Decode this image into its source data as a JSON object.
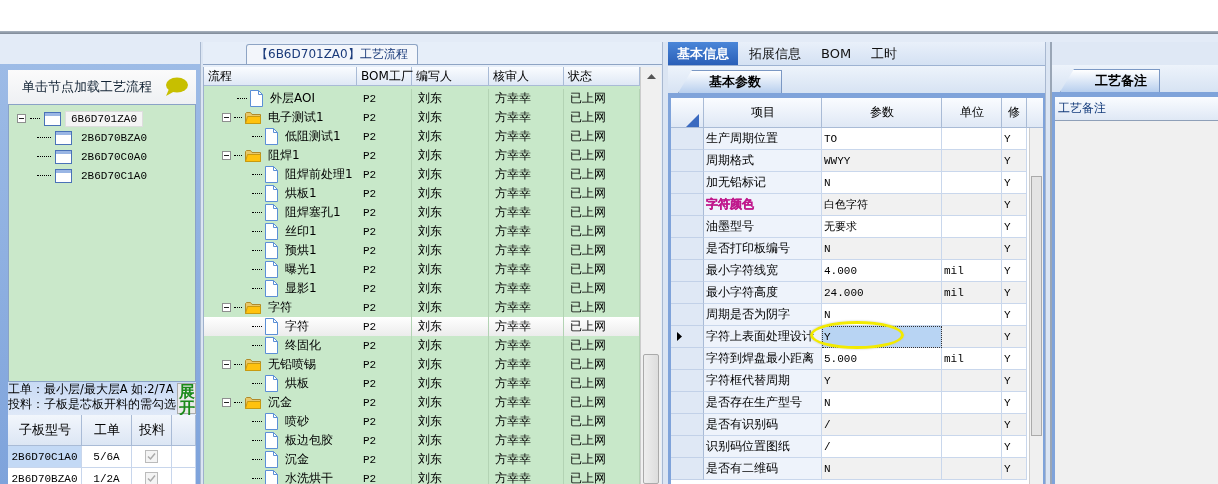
{
  "left_panel": {
    "header": "单击节点加载工艺流程",
    "tree": [
      {
        "label": "6B6D701ZA0",
        "expanded": true,
        "selected": true,
        "children": [
          {
            "label": "2B6D70BZA0",
            "selected": false
          },
          {
            "label": "2B6D70C0A0",
            "selected": false
          },
          {
            "label": "2B6D70C1A0",
            "selected": false
          }
        ]
      }
    ],
    "hint_lines": [
      "工单：最小层/最大层A 如:2/7A",
      "投料：子板是芯板开料的需勾选"
    ],
    "expand_button": "展开",
    "grid": {
      "columns": [
        "子板型号",
        "工单",
        "投料"
      ],
      "rows": [
        {
          "cells": [
            "2B6D70C1A0",
            "5/6A"
          ],
          "checked": true,
          "selected": true
        },
        {
          "cells": [
            "2B6D70BZA0",
            "1/2A"
          ],
          "checked": true,
          "selected": false
        }
      ]
    }
  },
  "flow_panel": {
    "title": "【6B6D701ZA0】工艺流程",
    "columns": [
      "流程",
      "BOM工厂",
      "编写人",
      "核审人",
      "状态"
    ],
    "tree": [
      {
        "kind": "step",
        "label": "外层AOI",
        "cells": [
          "P2",
          "刘东",
          "方幸幸",
          "已上网"
        ],
        "selected": false
      },
      {
        "kind": "folder",
        "label": "电子测试1",
        "cells": [
          "P2",
          "刘东",
          "方幸幸",
          "已上网"
        ],
        "expanded": true,
        "selected": false,
        "children": [
          {
            "kind": "step",
            "label": "低阻测试1",
            "cells": [
              "P2",
              "刘东",
              "方幸幸",
              "已上网"
            ],
            "selected": false
          }
        ]
      },
      {
        "kind": "folder",
        "label": "阻焊1",
        "cells": [
          "P2",
          "刘东",
          "方幸幸",
          "已上网"
        ],
        "expanded": true,
        "selected": false,
        "children": [
          {
            "kind": "step",
            "label": "阻焊前处理1",
            "cells": [
              "P2",
              "刘东",
              "方幸幸",
              "已上网"
            ],
            "selected": false
          },
          {
            "kind": "step",
            "label": "烘板1",
            "cells": [
              "P2",
              "刘东",
              "方幸幸",
              "已上网"
            ],
            "selected": false
          },
          {
            "kind": "step",
            "label": "阻焊塞孔1",
            "cells": [
              "P2",
              "刘东",
              "方幸幸",
              "已上网"
            ],
            "selected": false
          },
          {
            "kind": "step",
            "label": "丝印1",
            "cells": [
              "P2",
              "刘东",
              "方幸幸",
              "已上网"
            ],
            "selected": false
          },
          {
            "kind": "step",
            "label": "预烘1",
            "cells": [
              "P2",
              "刘东",
              "方幸幸",
              "已上网"
            ],
            "selected": false
          },
          {
            "kind": "step",
            "label": "曝光1",
            "cells": [
              "P2",
              "刘东",
              "方幸幸",
              "已上网"
            ],
            "selected": false
          },
          {
            "kind": "step",
            "label": "显影1",
            "cells": [
              "P2",
              "刘东",
              "方幸幸",
              "已上网"
            ],
            "selected": false
          }
        ]
      },
      {
        "kind": "folder",
        "label": "字符",
        "cells": [
          "P2",
          "刘东",
          "方幸幸",
          "已上网"
        ],
        "expanded": true,
        "selected": false,
        "children": [
          {
            "kind": "step",
            "label": "字符",
            "cells": [
              "P2",
              "刘东",
              "方幸幸",
              "已上网"
            ],
            "selected": true
          },
          {
            "kind": "step",
            "label": "终固化",
            "cells": [
              "P2",
              "刘东",
              "方幸幸",
              "已上网"
            ],
            "selected": false
          }
        ]
      },
      {
        "kind": "folder",
        "label": "无铅喷锡",
        "cells": [
          "P2",
          "刘东",
          "方幸幸",
          "已上网"
        ],
        "expanded": true,
        "selected": false,
        "children": [
          {
            "kind": "step",
            "label": "烘板",
            "cells": [
              "P2",
              "刘东",
              "方幸幸",
              "已上网"
            ],
            "selected": false
          }
        ]
      },
      {
        "kind": "folder",
        "label": "沉金",
        "cells": [
          "P2",
          "刘东",
          "方幸幸",
          "已上网"
        ],
        "expanded": true,
        "selected": false,
        "children": [
          {
            "kind": "step",
            "label": "喷砂",
            "cells": [
              "P2",
              "刘东",
              "方幸幸",
              "已上网"
            ],
            "selected": false
          },
          {
            "kind": "step",
            "label": "板边包胶",
            "cells": [
              "P2",
              "刘东",
              "方幸幸",
              "已上网"
            ],
            "selected": false
          },
          {
            "kind": "step",
            "label": "沉金",
            "cells": [
              "P2",
              "刘东",
              "方幸幸",
              "已上网"
            ],
            "selected": false
          },
          {
            "kind": "step",
            "label": "水洗烘干",
            "cells": [
              "P2",
              "刘东",
              "方幸幸",
              "已上网"
            ],
            "selected": false
          }
        ]
      }
    ]
  },
  "param_panel": {
    "tabs": [
      {
        "label": "基本信息",
        "selected": true
      },
      {
        "label": "拓展信息",
        "selected": false
      },
      {
        "label": "BOM",
        "selected": false
      },
      {
        "label": "工时",
        "selected": false
      }
    ],
    "subtab": "基本参数",
    "columns": [
      "项目",
      "参数",
      "单位",
      "修"
    ],
    "rows": [
      {
        "item": "生产周期位置",
        "value": "TO",
        "column_4": "Y",
        "selected": false,
        "circled": false
      },
      {
        "item": "周期格式",
        "value": "WWYY",
        "column_4": "Y",
        "selected": false,
        "circled": false
      },
      {
        "item": "加无铅标记",
        "value": "N",
        "column_4": "Y",
        "selected": false,
        "circled": false
      },
      {
        "item": "字符颜色",
        "color": "#c0188c",
        "value": "白色字符",
        "column_4": "Y",
        "selected": false,
        "circled": false
      },
      {
        "item": "油墨型号",
        "value": "无要求",
        "column_4": "Y",
        "selected": false,
        "circled": false
      },
      {
        "item": "是否打印板编号",
        "value": "N",
        "column_4": "Y",
        "selected": false,
        "circled": false
      },
      {
        "item": "最小字符线宽",
        "value": "4.000",
        "unit": "mil",
        "column_4": "Y",
        "selected": false,
        "circled": false
      },
      {
        "item": "最小字符高度",
        "value": "24.000",
        "unit": "mil",
        "column_4": "Y",
        "selected": false,
        "circled": false
      },
      {
        "item": "周期是否为阴字",
        "value": "N",
        "column_4": "Y",
        "selected": false,
        "circled": false
      },
      {
        "item": "字符上表面处理设计",
        "value": "Y",
        "column_4": "Y",
        "selected": true,
        "circled": true
      },
      {
        "item": "字符到焊盘最小距离",
        "value": "5.000",
        "unit": "mil",
        "column_4": "Y",
        "selected": false,
        "circled": false
      },
      {
        "item": "字符框代替周期",
        "value": "Y",
        "column_4": "Y",
        "selected": false,
        "circled": false
      },
      {
        "item": "是否存在生产型号",
        "value": "N",
        "column_4": "Y",
        "selected": false,
        "circled": false
      },
      {
        "item": "是否有识别码",
        "value": "/",
        "column_4": "Y",
        "selected": false,
        "circled": false
      },
      {
        "item": "识别码位置图纸",
        "value": "/",
        "column_4": "Y",
        "selected": false,
        "circled": false
      },
      {
        "item": "是否有二维码",
        "value": "N",
        "column_4": "Y",
        "selected": false,
        "circled": false
      }
    ]
  },
  "note_panel": {
    "tab": "工艺备注",
    "header": "工艺备注"
  }
}
